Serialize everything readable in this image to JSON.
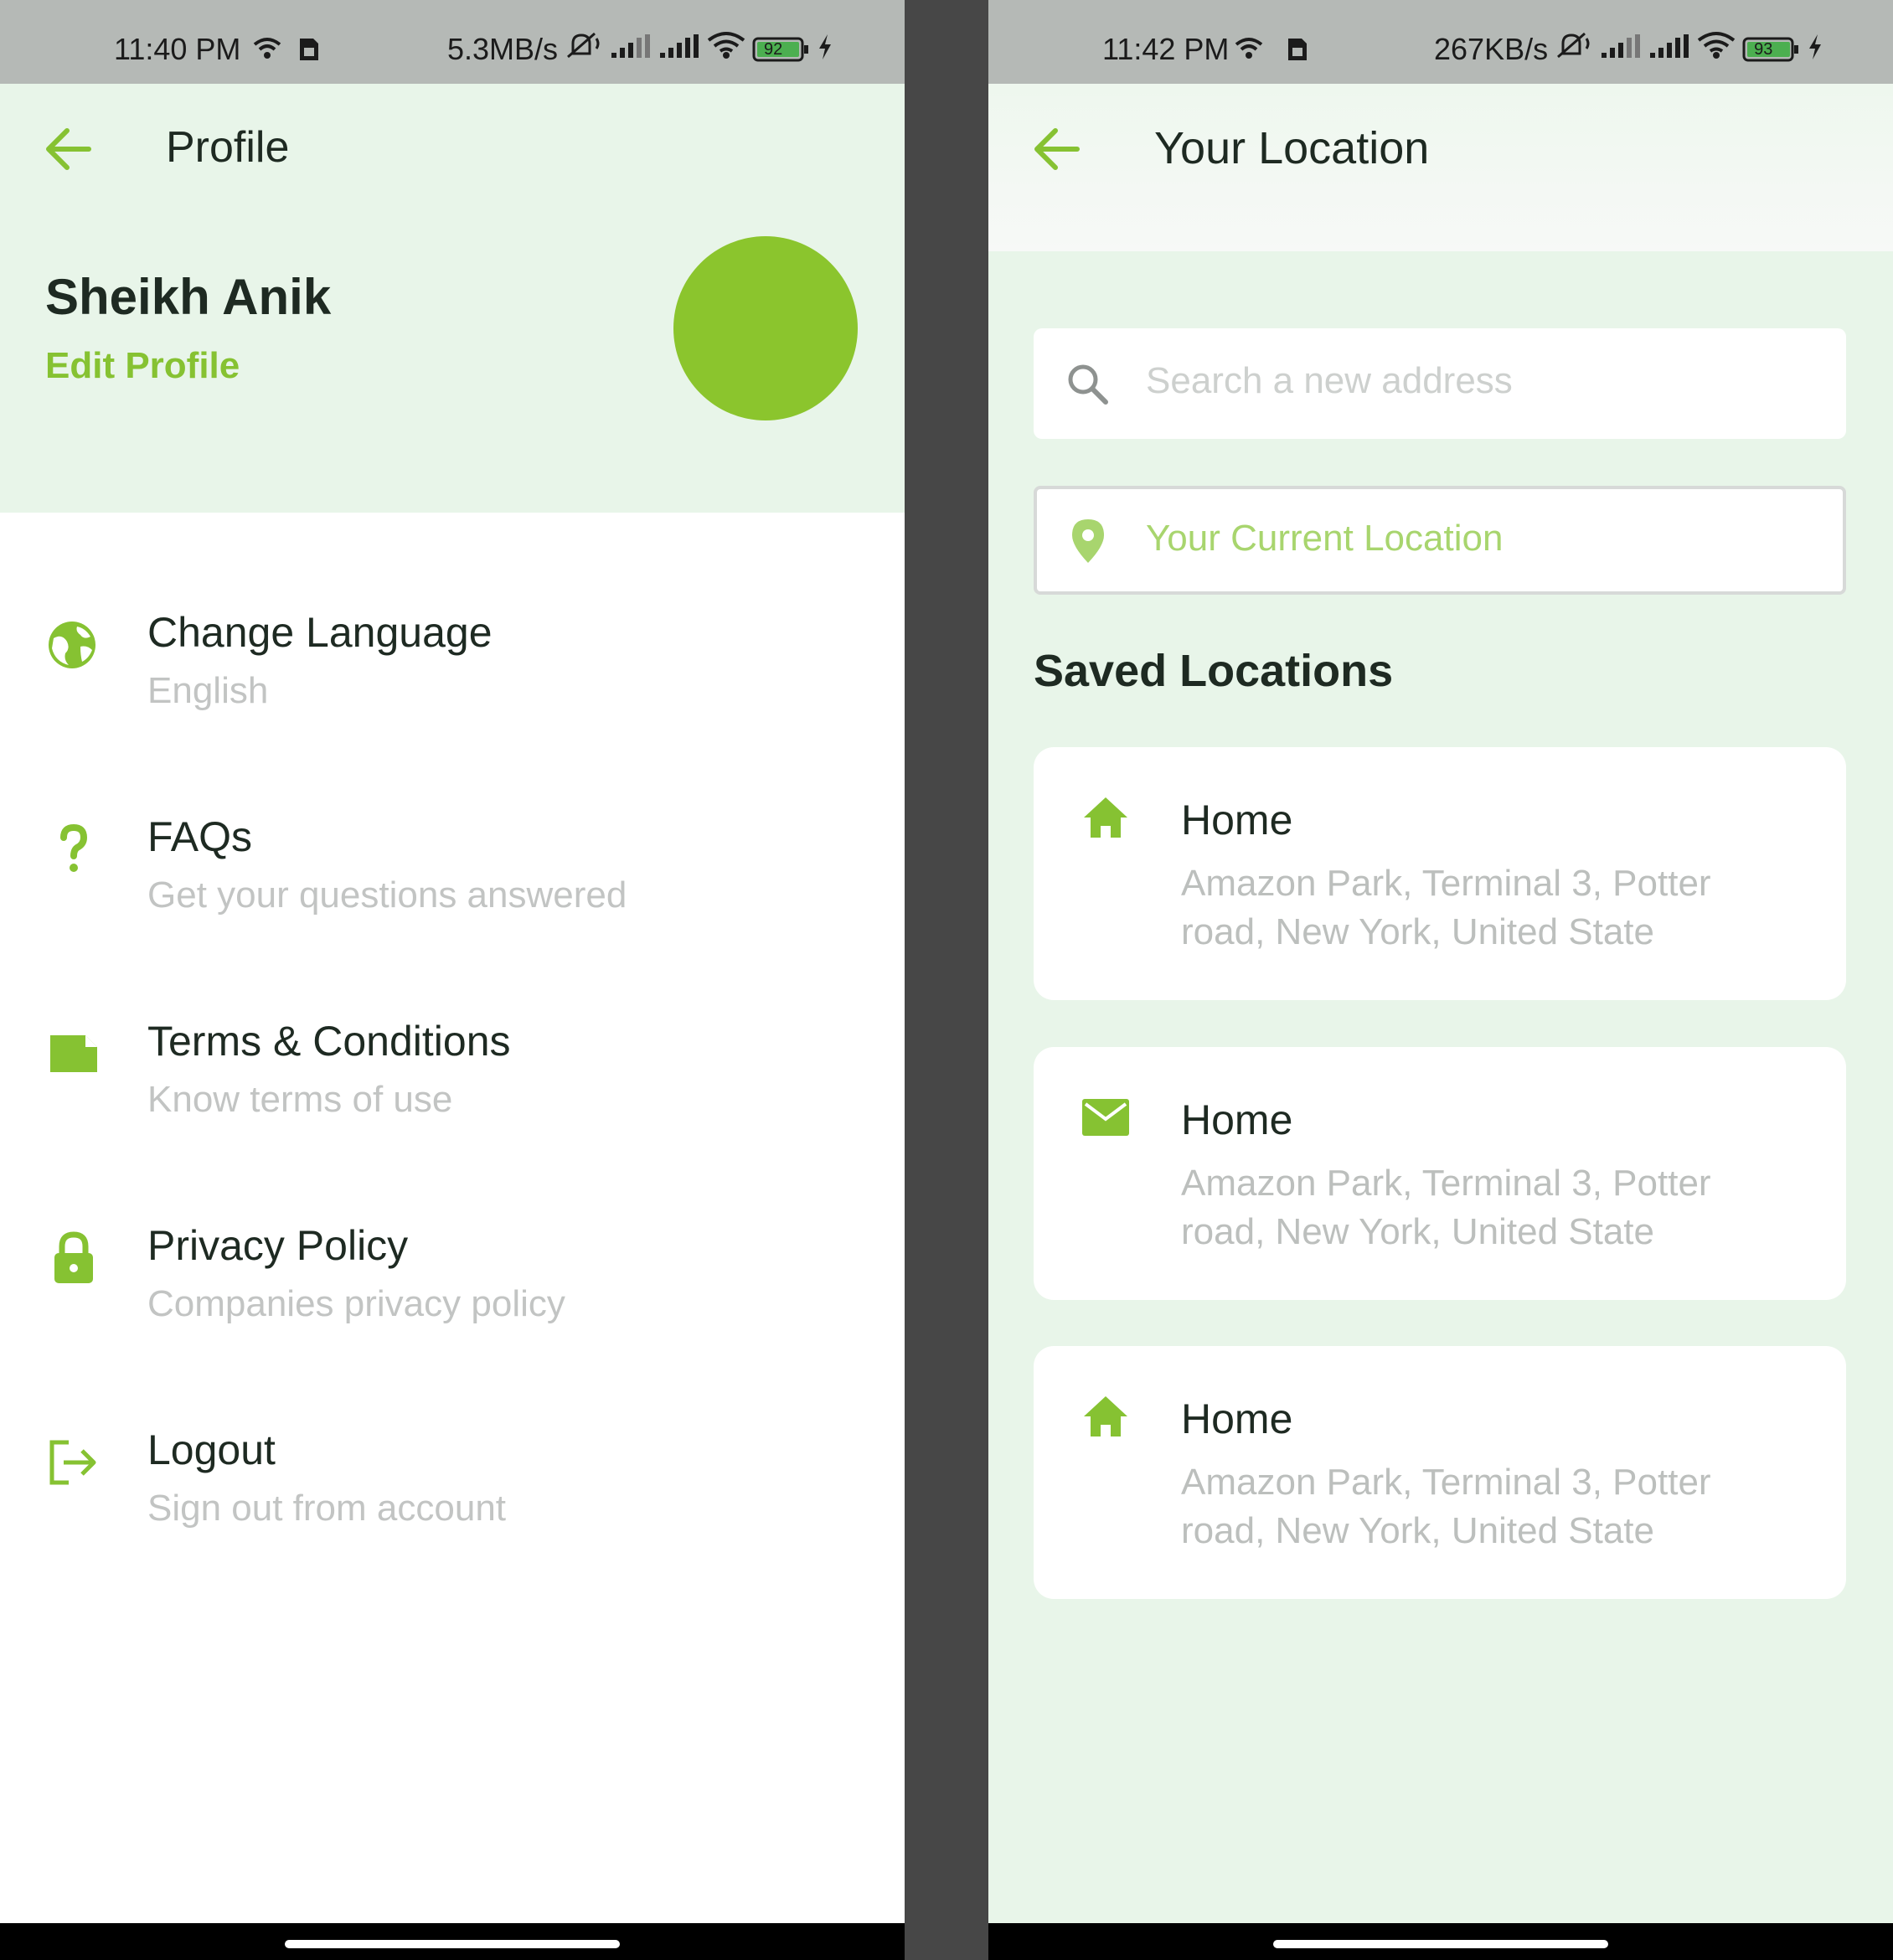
{
  "colors": {
    "accent": "#86c232",
    "avatar": "#8bc52d",
    "header_bg": "#e8f5e9",
    "status_bar_bg": "#b5b9b6",
    "divider_bg": "#474747"
  },
  "left_screen": {
    "status_bar": {
      "time": "11:40 PM",
      "speed": "5.3MB/s",
      "battery": "92"
    },
    "header": {
      "title": "Profile",
      "back_icon": "arrow-left-icon"
    },
    "profile": {
      "name": "Sheikh Anik",
      "edit_label": "Edit Profile"
    },
    "menu": [
      {
        "icon": "globe-icon",
        "title": "Change Language",
        "subtitle": "English"
      },
      {
        "icon": "question-icon",
        "title": "FAQs",
        "subtitle": "Get your questions answered"
      },
      {
        "icon": "document-icon",
        "title": "Terms & Conditions",
        "subtitle": "Know terms of use"
      },
      {
        "icon": "lock-icon",
        "title": "Privacy Policy",
        "subtitle": "Companies privacy policy"
      },
      {
        "icon": "logout-icon",
        "title": "Logout",
        "subtitle": "Sign out from account"
      }
    ]
  },
  "right_screen": {
    "status_bar": {
      "time": "11:42 PM",
      "speed": "267KB/s",
      "battery": "93"
    },
    "header": {
      "title": "Your Location",
      "back_icon": "arrow-left-icon"
    },
    "search": {
      "placeholder": "Search a new address",
      "icon": "search-icon"
    },
    "current_location": {
      "label": "Your Current Location",
      "icon": "map-pin-icon"
    },
    "saved_title": "Saved Locations",
    "saved_locations": [
      {
        "icon": "home-icon",
        "name": "Home",
        "address": "Amazon Park, Terminal 3, Potter road, New York, United State"
      },
      {
        "icon": "mail-icon",
        "name": "Home",
        "address": "Amazon Park, Terminal 3, Potter road, New York, United State"
      },
      {
        "icon": "home-icon",
        "name": "Home",
        "address": "Amazon Park, Terminal 3, Potter road, New York, United State"
      }
    ]
  }
}
